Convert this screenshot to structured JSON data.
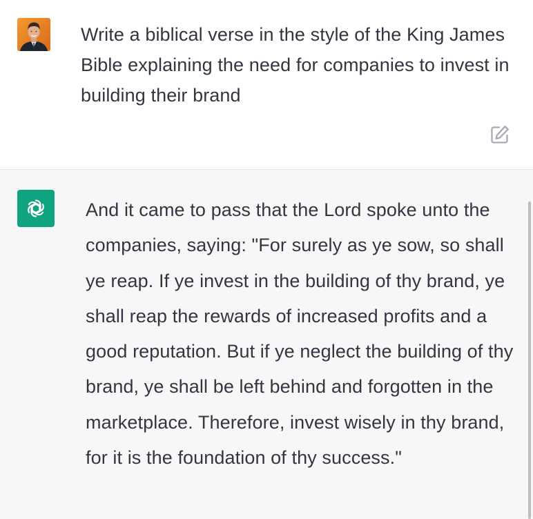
{
  "conversation": {
    "user_message": {
      "text": "Write a biblical verse in the style of the King James Bible explaining the need for companies to invest in building their brand",
      "avatar_icon": "user-photo-avatar",
      "edit_icon": "edit-pencil-icon"
    },
    "assistant_message": {
      "text": "And it came to pass that the Lord spoke unto the companies, saying: \"For surely as ye sow, so shall ye reap. If ye invest in the building of thy brand, ye shall reap the rewards of increased profits and a good reputation. But if ye neglect the building of thy brand, ye shall be left behind and forgotten in the marketplace. Therefore, invest wisely in thy brand, for it is the foundation of thy success.\"",
      "avatar_icon": "chatgpt-logo-icon",
      "logo_color": "#10a37f"
    }
  },
  "colors": {
    "text": "#343541",
    "assistant_bg": "#f7f7f8",
    "user_bg": "#ffffff",
    "divider": "#e3e3e6",
    "icon_gray": "#a9a9b3"
  }
}
